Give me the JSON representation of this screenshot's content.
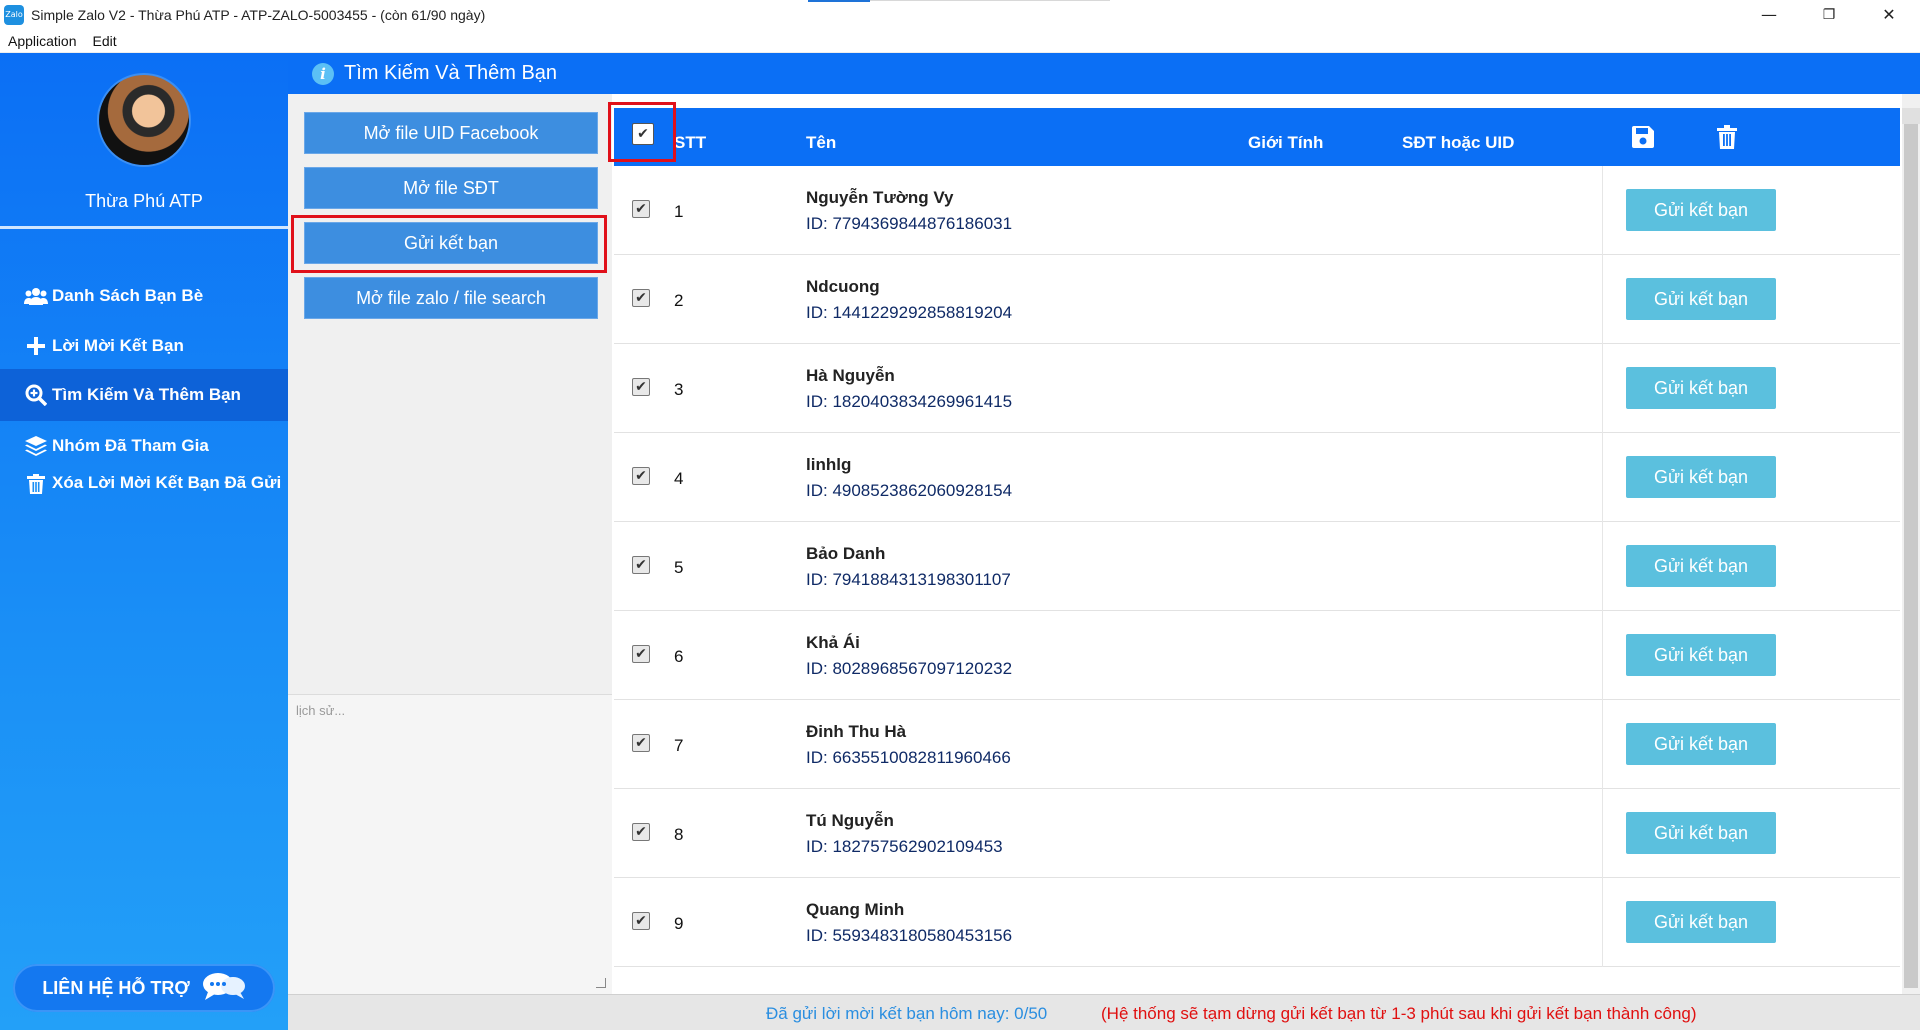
{
  "window": {
    "title": "Simple Zalo V2 - Thừa Phú ATP - ATP-ZALO-5003455 - (còn 61/90 ngày)",
    "app_icon_text": "Zalo",
    "minimize": "—",
    "restore": "❐",
    "close": "✕"
  },
  "menu": [
    "Application",
    "Edit"
  ],
  "user": {
    "name": "Thừa Phú ATP"
  },
  "sidebar": {
    "items": [
      {
        "label": "Danh Sách Bạn Bè",
        "icon": "users-icon"
      },
      {
        "label": "Lời Mời Kết Bạn",
        "icon": "plus-icon"
      },
      {
        "label": "Tìm Kiếm Và Thêm Bạn",
        "icon": "search-plus-icon",
        "active": true
      },
      {
        "label": "Nhóm Đã Tham Gia",
        "icon": "layers-icon"
      },
      {
        "label": "Xóa Lời Mời Kết Bạn Đã Gửi",
        "icon": "trash-icon"
      }
    ],
    "support": "LIÊN HỆ HỖ TRỢ"
  },
  "header": {
    "title": "Tìm Kiếm Và Thêm Bạn"
  },
  "actions": {
    "open_uid_facebook": "Mở file UID Facebook",
    "open_phone": "Mở file SĐT",
    "send_request": "Gửi kết bạn",
    "open_zalo_file": "Mở file zalo / file search"
  },
  "history": {
    "placeholder": "lịch sử..."
  },
  "table": {
    "columns": {
      "stt": "STT",
      "name": "Tên",
      "gender": "Giới Tính",
      "phone": "SĐT hoặc UID"
    },
    "row_button": "Gửi kết bạn",
    "rows": [
      {
        "stt": "1",
        "name": "Nguyễn Tường Vy",
        "id": "ID: 7794369844876186031"
      },
      {
        "stt": "2",
        "name": "Ndcuong",
        "id": "ID: 1441229292858819204"
      },
      {
        "stt": "3",
        "name": "Hà Nguyễn",
        "id": "ID: 1820403834269961415"
      },
      {
        "stt": "4",
        "name": "linhlg",
        "id": "ID: 4908523862060928154"
      },
      {
        "stt": "5",
        "name": "Bảo Danh",
        "id": "ID: 7941884313198301107"
      },
      {
        "stt": "6",
        "name": "Khả Ái",
        "id": "ID: 8028968567097120232"
      },
      {
        "stt": "7",
        "name": "Đinh Thu Hà",
        "id": "ID: 6635510082811960466"
      },
      {
        "stt": "8",
        "name": "Tú Nguyễn",
        "id": "ID: 182757562902109453"
      },
      {
        "stt": "9",
        "name": "Quang Minh",
        "id": "ID: 5593483180580453156"
      }
    ]
  },
  "status": {
    "sent_today": "Đã gửi lời mời kết bạn hôm nay: 0/50",
    "notice": "(Hệ thống sẽ tạm dừng gửi kết bạn từ 1-3 phút sau khi gửi kết bạn thành công)"
  },
  "colors": {
    "primary": "#0b6ff5",
    "button": "#3d8ee0",
    "row_button": "#5bc0de",
    "highlight": "#e0101a"
  }
}
